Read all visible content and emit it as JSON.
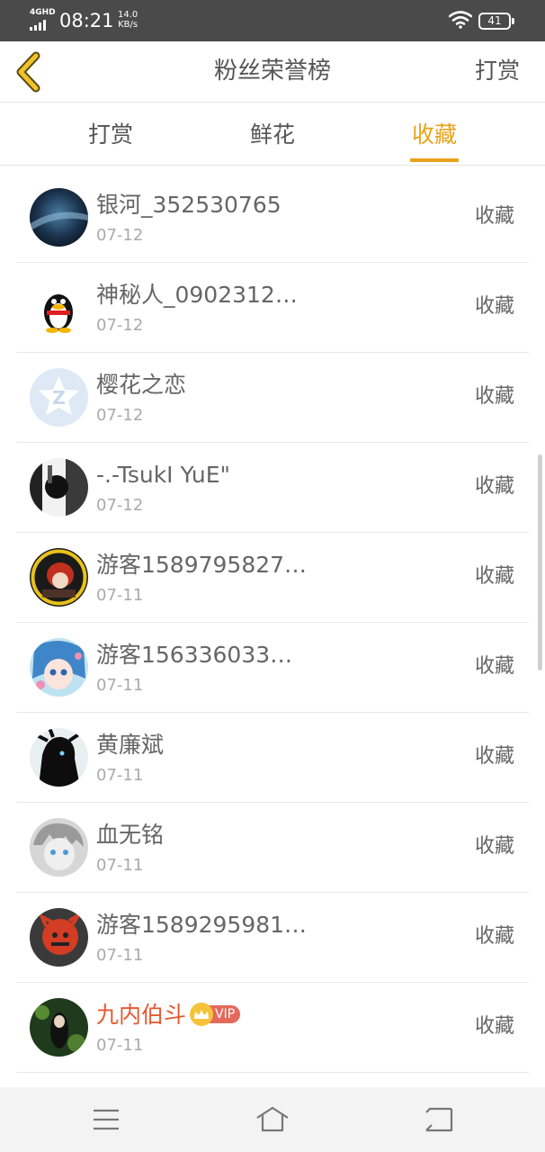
{
  "status_bar": {
    "network": "4GHD",
    "time": "08:21",
    "speed_value": "14.0",
    "speed_unit": "KB/s",
    "battery": "41"
  },
  "header": {
    "back_icon": "chevron-left-icon",
    "title": "粉丝荣誉榜",
    "action": "打赏"
  },
  "tabs": [
    {
      "label": "打赏",
      "active": false
    },
    {
      "label": "鲜花",
      "active": false
    },
    {
      "label": "收藏",
      "active": true
    }
  ],
  "rows": [
    {
      "name": "银河_352530765",
      "date": "07-12",
      "action": "收藏",
      "vip": false
    },
    {
      "name": "神秘人_0902312…",
      "date": "07-12",
      "action": "收藏",
      "vip": false
    },
    {
      "name": "樱花之恋",
      "date": "07-12",
      "action": "收藏",
      "vip": false
    },
    {
      "name": "‐.‐TsukI YuE\"",
      "date": "07-12",
      "action": "收藏",
      "vip": false
    },
    {
      "name": "游客1589795827…",
      "date": "07-11",
      "action": "收藏",
      "vip": false
    },
    {
      "name": "游客156336033…",
      "date": "07-11",
      "action": "收藏",
      "vip": false
    },
    {
      "name": "黄廉斌",
      "date": "07-11",
      "action": "收藏",
      "vip": false
    },
    {
      "name": "血无铭",
      "date": "07-11",
      "action": "收藏",
      "vip": false
    },
    {
      "name": "游客1589295981…",
      "date": "07-11",
      "action": "收藏",
      "vip": false
    },
    {
      "name": "九内伯斗",
      "date": "07-11",
      "action": "收藏",
      "vip": true,
      "vip_label": "VIP"
    }
  ],
  "colors": {
    "accent": "#e8a31b",
    "vip_name": "#e45a32",
    "status_bar": "#4a4a4a"
  },
  "nav": {
    "menu_icon": "menu-icon",
    "home_icon": "home-icon",
    "back_icon": "return-icon"
  }
}
